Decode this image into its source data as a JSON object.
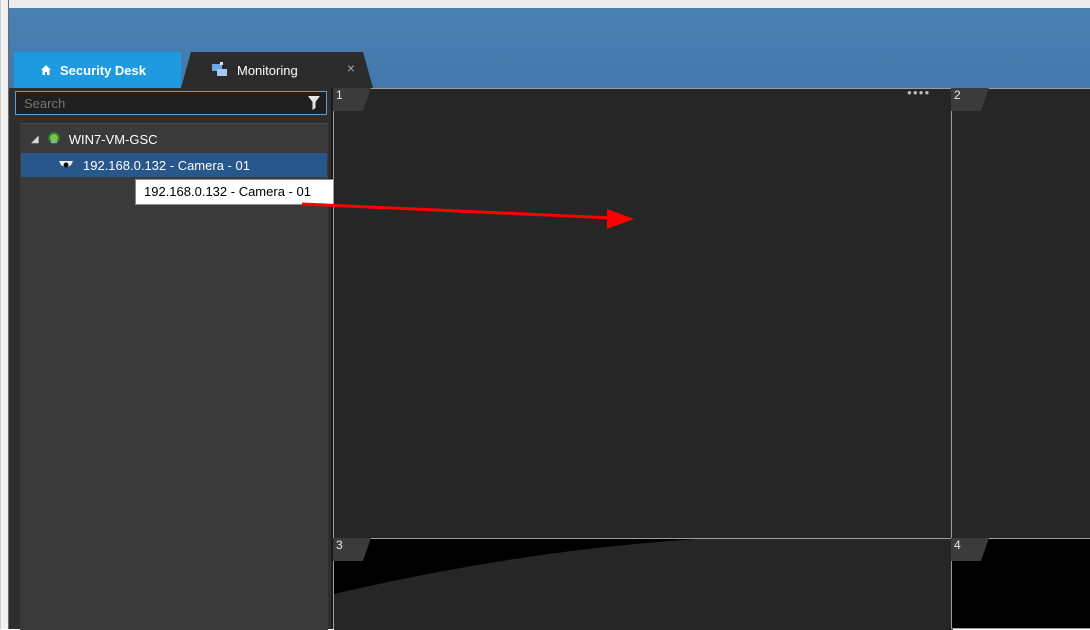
{
  "tabs": [
    {
      "label": "Security Desk",
      "icon": "home-icon"
    },
    {
      "label": "Monitoring",
      "icon": "monitoring-icon",
      "close": "×"
    }
  ],
  "sidebar": {
    "search_placeholder": "Search",
    "tree": {
      "root": "WIN7-VM-GSC",
      "child": "192.168.0.132 - Camera - 01"
    },
    "tooltip": "192.168.0.132 - Camera - 01"
  },
  "tiles": [
    {
      "number": "1"
    },
    {
      "number": "2"
    },
    {
      "number": "3"
    },
    {
      "number": "4"
    }
  ],
  "colors": {
    "titlebar": "#4a80b2",
    "home_tab": "#1e9be0",
    "selection": "#27578b",
    "arrow": "#ff0000"
  }
}
